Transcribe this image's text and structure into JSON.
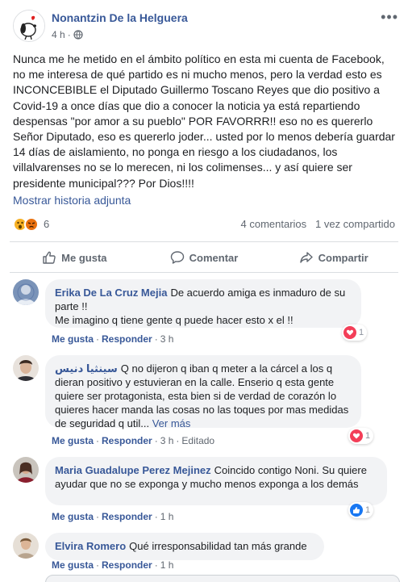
{
  "post": {
    "author": "Nonantzin De la Helguera",
    "time": "4 h",
    "separator": "·",
    "text": "Nunca me he metido en el ámbito político en esta mi cuenta de Facebook, no me interesa de qué partido es ni mucho menos, pero la verdad esto es INCONCEBIBLE el Diputado Guillermo Toscano Reyes que dio positivo a Covid-19 a once días que dio a conocer la noticia ya está repartiendo despensas \"por amor a su pueblo\" POR FAVORRR!! eso no es quererlo Señor Diputado, eso es quererlo joder... usted por lo menos debería guardar 14 días de aislamiento, no ponga en riesgo a los ciudadanos, los villalvarenses no se lo merecen, ni los colimenses... y así quiere ser presidente municipal??? Por Dios!!!!",
    "see_attached": "Mostrar historia adjunta",
    "reaction_icons": [
      "wow-icon",
      "angry-icon"
    ],
    "reaction_count": "6",
    "comments_count": "4 comentarios",
    "shares_count": "1 vez compartido"
  },
  "actions": {
    "like": "Me gusta",
    "comment": "Comentar",
    "share": "Compartir"
  },
  "comments": [
    {
      "name": "Erika De La Cruz Mejia",
      "text": "De acuerdo amiga es inmaduro de su parte !!",
      "text2": "Me imagino q tiene gente q puede hacer esto x el !!",
      "like": "Me gusta",
      "reply": "Responder",
      "time": "3 h",
      "reaction": "love",
      "reaction_count": "1"
    },
    {
      "name": "سينثيا دنيس",
      "text": "Q no dijeron q iban q meter a la cárcel a los q dieran positivo y estuvieran en la calle. Enserio q esta gente quiere ser protagonista, esta bien si de verdad de corazón lo quieres hacer manda las cosas no las toques por mas medidas de seguridad q util...",
      "see_more": "Ver más",
      "like": "Me gusta",
      "reply": "Responder",
      "time": "3 h",
      "edited": "Editado",
      "reaction": "love",
      "reaction_count": "1"
    },
    {
      "name": "Maria Guadalupe Perez Mejinez",
      "text": "Coincido contigo Noni. Su quiere ayudar que no se exponga y mucho menos exponga a los demás",
      "like": "Me gusta",
      "reply": "Responder",
      "time": "1 h",
      "reaction": "like",
      "reaction_count": "1"
    },
    {
      "name": "Elvira Romero",
      "text": "Qué irresponsabilidad tan más grande",
      "like": "Me gusta",
      "reply": "Responder",
      "time": "1 h"
    }
  ],
  "colors": {
    "link": "#385898",
    "secondary": "#606770",
    "bubble": "#f2f3f5",
    "love": "#f33e58",
    "like": "#1877f2"
  }
}
